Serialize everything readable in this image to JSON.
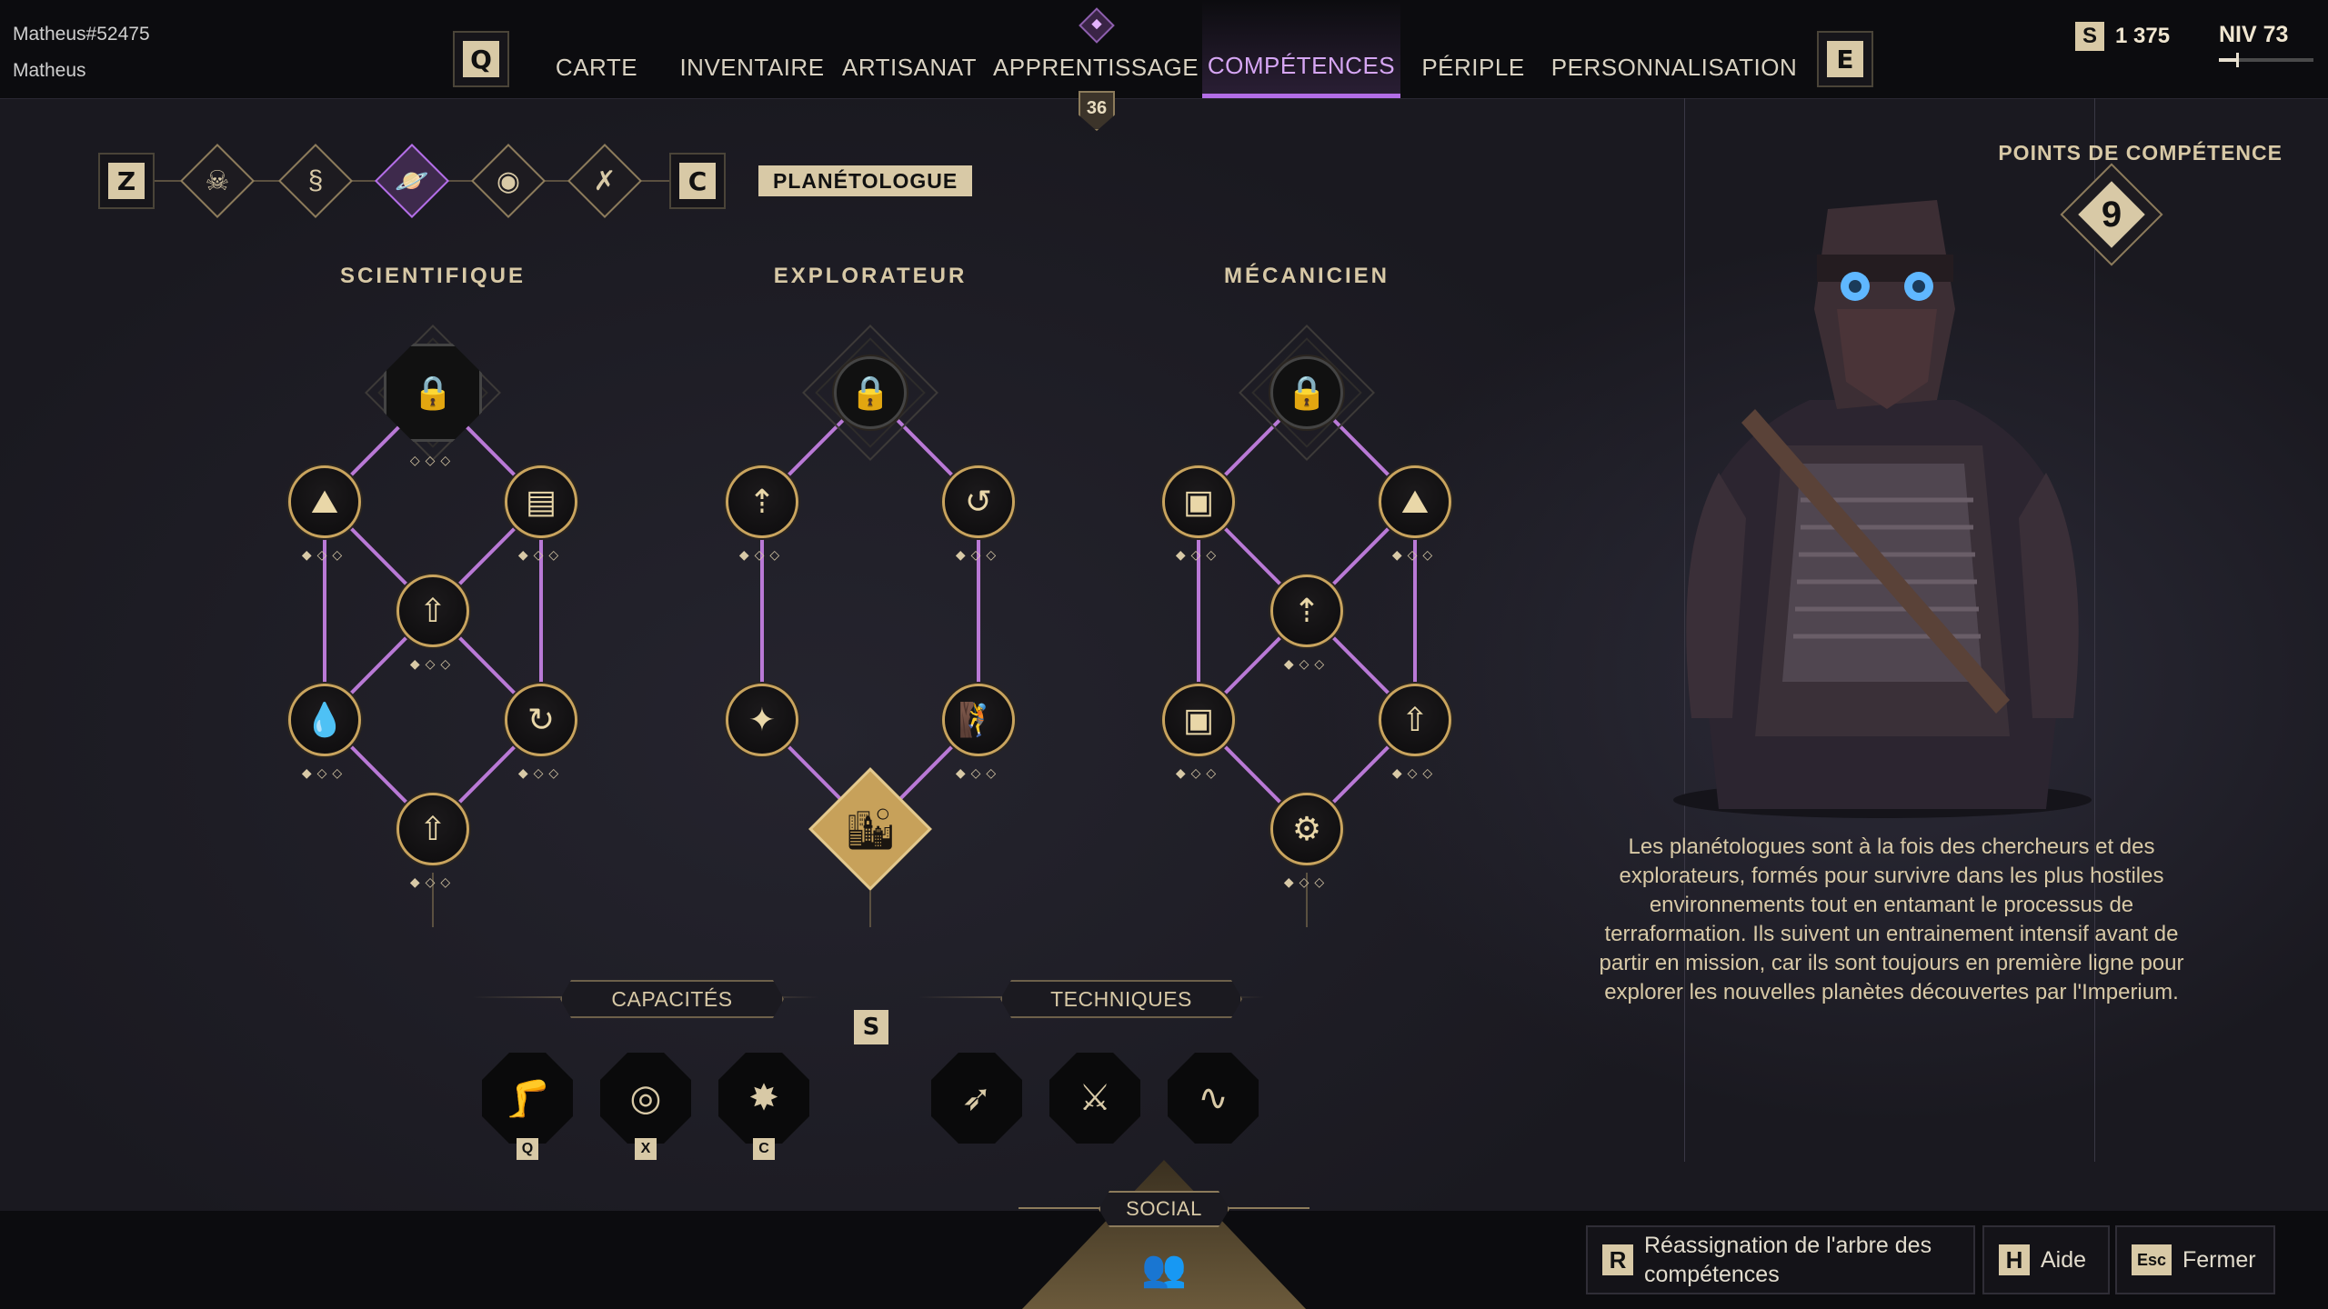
{
  "user": {
    "tag": "Matheus#52475",
    "name": "Matheus"
  },
  "nav": {
    "key_left": "Q",
    "key_right": "E",
    "tabs": [
      "CARTE",
      "INVENTAIRE",
      "ARTISANAT",
      "APPRENTISSAGE",
      "COMPÉTENCES",
      "PÉRIPLE",
      "PERSONNALISATION"
    ],
    "active_tab": "COMPÉTENCES",
    "apprentissage_badge": "36"
  },
  "currency": {
    "icon": "solari-icon",
    "symbol": "S",
    "amount": "1 375"
  },
  "level": {
    "label": "NIV 73",
    "progress": 0.18
  },
  "class_selector": {
    "key_left": "Z",
    "key_right": "C",
    "active_class": "PLANÉTOLOGUE",
    "classes": [
      {
        "icon": "mentat-icon",
        "active": false
      },
      {
        "icon": "swordmaster-icon",
        "active": false
      },
      {
        "icon": "planet-icon",
        "active": true
      },
      {
        "icon": "bene-gesserit-icon",
        "active": false
      },
      {
        "icon": "trooper-icon",
        "active": false
      }
    ]
  },
  "trees": [
    {
      "title": "SCIENTIFIQUE"
    },
    {
      "title": "EXPLORATEUR"
    },
    {
      "title": "MÉCANICIEN"
    }
  ],
  "abilities": {
    "capacities_label": "CAPACITÉS",
    "techniques_label": "TECHNIQUES",
    "center_key": "S",
    "capacities": [
      {
        "icon": "kick-icon",
        "key": "Q"
      },
      {
        "icon": "spin-icon",
        "key": "X"
      },
      {
        "icon": "explosive-icon",
        "key": "C"
      }
    ],
    "techniques": [
      {
        "icon": "dash-icon"
      },
      {
        "icon": "triple-blade-icon"
      },
      {
        "icon": "health-pulse-icon"
      }
    ]
  },
  "points": {
    "label": "POINTS DE COMPÉTENCE",
    "value": "9"
  },
  "description": "Les planétologues sont à la fois des chercheurs et des explorateurs, formés pour survivre dans les plus hostiles environnements tout en entamant le processus de terraformation. Ils suivent un entrainement intensif avant de partir en mission, car ils sont toujours en première ligne pour explorer les nouvelles planètes découvertes par l'Imperium.",
  "social": {
    "label": "SOCIAL"
  },
  "hints": {
    "reset_key": "R",
    "reset_label": "Réassignation de l'arbre des compétences",
    "help_key": "H",
    "help_label": "Aide",
    "close_key": "Esc",
    "close_label": "Fermer"
  }
}
